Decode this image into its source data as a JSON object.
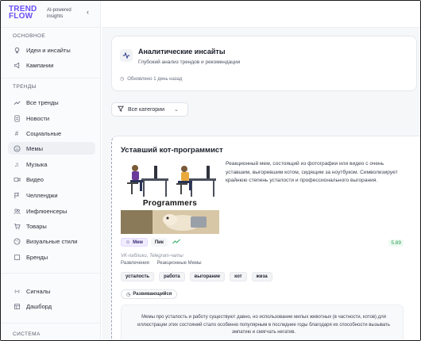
{
  "brand": {
    "logo_line1": "TREND",
    "logo_line2": "FLOW",
    "tagline": "AI-powered insights"
  },
  "sidebar": {
    "section_main": "ОСНОВНОЕ",
    "main_items": [
      {
        "label": "Идеи и инсайты",
        "icon": "lightbulb-icon"
      },
      {
        "label": "Кампании",
        "icon": "megaphone-icon"
      }
    ],
    "section_trends": "ТРЕНДЫ",
    "trend_items": [
      {
        "label": "Все тренды",
        "icon": "trend-icon"
      },
      {
        "label": "Новости",
        "icon": "document-icon"
      },
      {
        "label": "Социальные",
        "icon": "hash-icon"
      },
      {
        "label": "Мемы",
        "icon": "smile-icon",
        "active": true
      },
      {
        "label": "Музыка",
        "icon": "music-icon"
      },
      {
        "label": "Видео",
        "icon": "video-icon"
      },
      {
        "label": "Челленджи",
        "icon": "flag-icon"
      },
      {
        "label": "Инфлюенсеры",
        "icon": "users-icon"
      },
      {
        "label": "Товары",
        "icon": "cart-icon"
      },
      {
        "label": "Визуальные стили",
        "icon": "palette-icon"
      },
      {
        "label": "Бренды",
        "icon": "brand-icon"
      }
    ],
    "tools_items": [
      {
        "label": "Сигналы",
        "icon": "signal-icon"
      },
      {
        "label": "Дашборд",
        "icon": "dashboard-icon"
      }
    ],
    "section_system": "СИСТЕМА"
  },
  "insights": {
    "title": "Аналитические инсайты",
    "subtitle": "Глубокий анализ трендов и рекомендации",
    "updated": "Обновлено 1 день назад"
  },
  "filter": {
    "label": "Все категории"
  },
  "card": {
    "title": "Уставший кот-программист",
    "description": "Реакционный мем, состоящий из фотографии или видео с очень уставшим, выгоревшим котом, сидящим за ноутбуком. Символизирует крайнюю степень усталости и профессионального выгорания.",
    "image_caption": "Programmers",
    "badge_type": "Мем",
    "badge_phase": "Пик",
    "score": "5.89",
    "sources": "VK-паблики, Telegram-чаты",
    "categories": [
      "Развлечения",
      "Реакционные Мемы"
    ],
    "tags": [
      "усталость",
      "работа",
      "выгорание",
      "кот",
      "жиза"
    ],
    "status": "Развивающийся",
    "long_description": "Мемы про усталость и работу существуют давно, но использование милых животных (в частности, котов) для иллюстрации этих состояний стало особенно популярным в последние годы благодаря их способности вызывать эмпатию и смягчать негатив."
  },
  "colors": {
    "brand": "#6b4ef6",
    "accent_green": "#2f9e57",
    "active_bg": "#eef0f4"
  }
}
